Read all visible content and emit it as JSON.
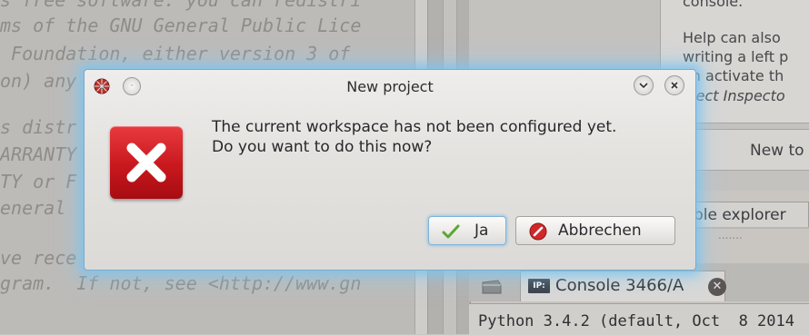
{
  "editor": {
    "lines": [
      "s free software: you can redistri",
      "ms of the GNU General Public Lice",
      " Foundation, either version 3 of",
      "on) any",
      "",
      "s distr",
      "ARRANTY",
      "TY or F",
      "eneral",
      "",
      "ve rece",
      "gram.  If not, see <http://www.gn"
    ]
  },
  "help_pane": {
    "top_text": "console.",
    "lines": [
      "Help can also",
      "writing a left p",
      "an activate th",
      "bject Inspecto"
    ],
    "new_button_label": "New to"
  },
  "right_tab": {
    "label": "ble explorer"
  },
  "console": {
    "tab_badge": "IP:",
    "tab_label": "Console 3466/A",
    "first_line": "Python 3.4.2 (default, Oct  8 2014"
  },
  "dialog": {
    "title": "New project",
    "message_line1": "The current workspace has not been configured yet.",
    "message_line2": "Do you want to do this now?",
    "yes_label": "Ja",
    "cancel_label": "Abbrechen"
  },
  "colors": {
    "glow": "#78c3f0",
    "error_red": "#c8181e",
    "check_green": "#5aa830",
    "cancel_red": "#d0282a"
  }
}
